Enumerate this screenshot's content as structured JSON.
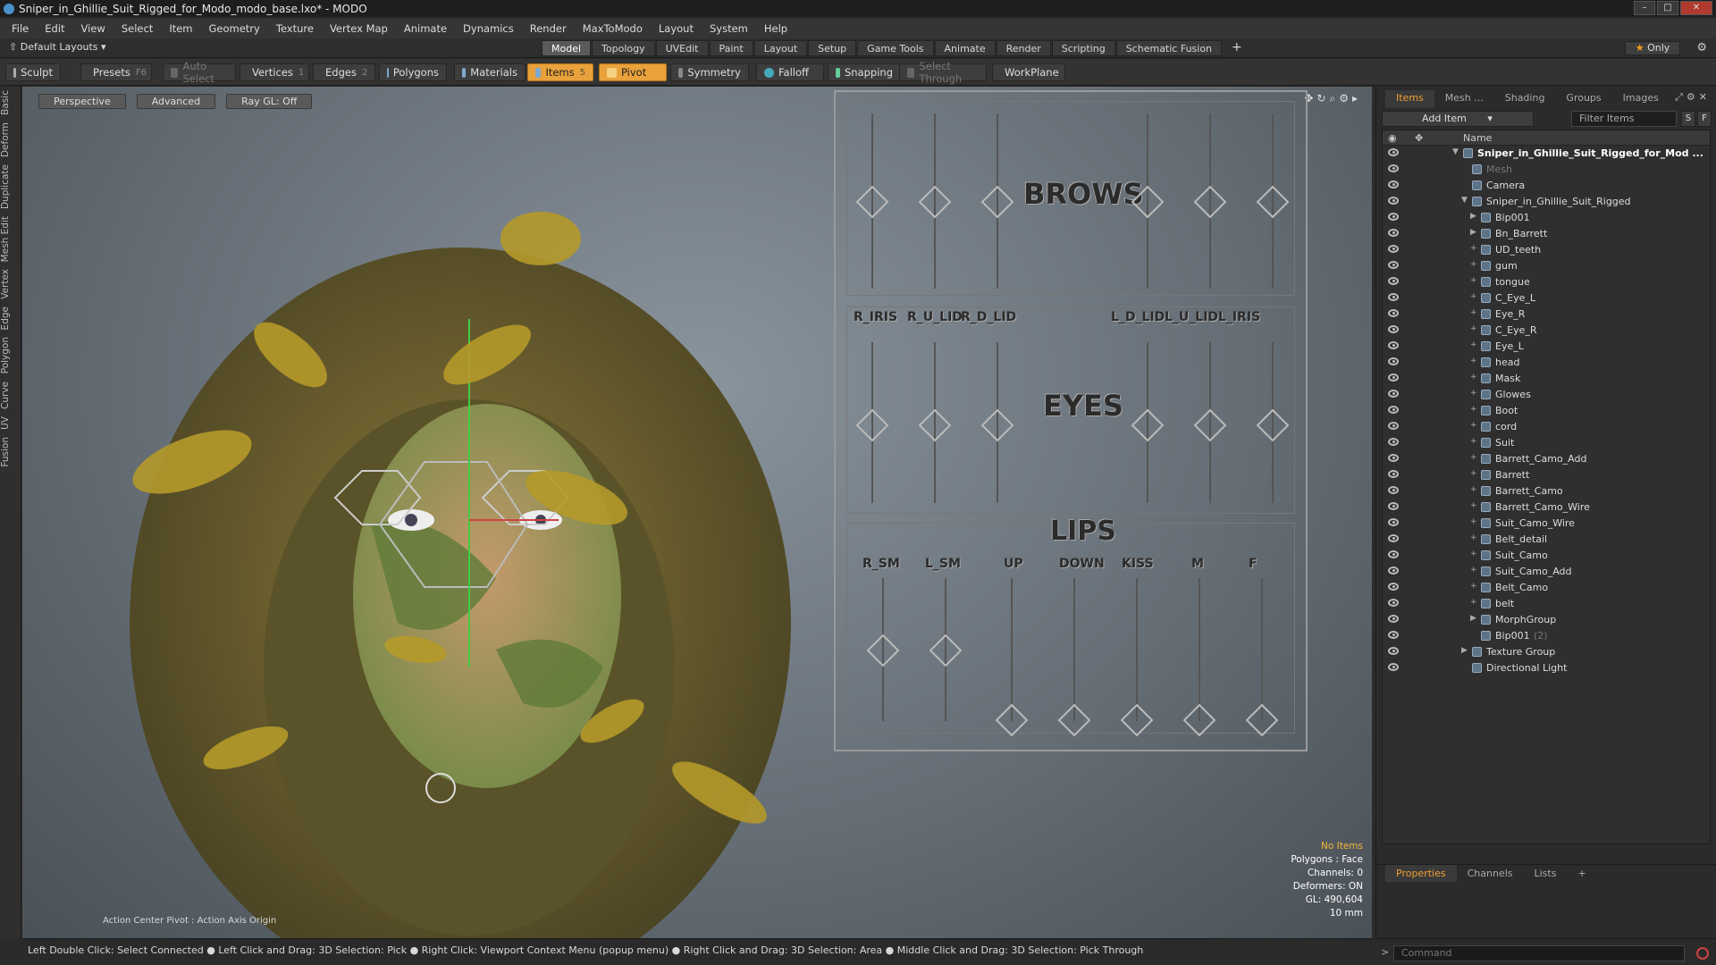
{
  "window": {
    "title": "Sniper_in_Ghillie_Suit_Rigged_for_Modo_modo_base.lxo* - MODO"
  },
  "menu": [
    "File",
    "Edit",
    "View",
    "Select",
    "Item",
    "Geometry",
    "Texture",
    "Vertex Map",
    "Animate",
    "Dynamics",
    "Render",
    "MaxToModo",
    "Layout",
    "System",
    "Help"
  ],
  "layout": {
    "selector": "Default Layouts ▾",
    "tabs": [
      "Model",
      "Topology",
      "UVEdit",
      "Paint",
      "Layout",
      "Setup",
      "Game Tools",
      "Animate",
      "Render",
      "Scripting",
      "Schematic Fusion"
    ],
    "active_tab": "Model",
    "only_label": "Only"
  },
  "toolbar": {
    "sculpt": "Sculpt",
    "presets": "Presets",
    "presets_key": "F6",
    "auto_select": "Auto Select",
    "vertices": "Vertices",
    "vertices_key": "1",
    "edges": "Edges",
    "edges_key": "2",
    "polygons": "Polygons",
    "materials": "Materials",
    "items": "Items",
    "items_key": "5",
    "pivot": "Pivot",
    "symmetry": "Symmetry",
    "falloff": "Falloff",
    "snapping": "Snapping",
    "select_through": "Select Through",
    "workplane": "WorkPlane"
  },
  "left_tabs": [
    "Basic",
    "Deform",
    "Duplicate",
    "Mesh Edit",
    "Vertex",
    "Edge",
    "Polygon",
    "Curve",
    "UV",
    "Fusion"
  ],
  "viewport": {
    "buttons": [
      "Perspective",
      "Advanced",
      "Ray GL: Off"
    ],
    "rig": {
      "brows": "BROWS",
      "eyes": "EYES",
      "lips": "LIPS",
      "eye_labels": [
        "R_IRIS",
        "R_U_LID",
        "R_D_LID",
        "L_D_LID",
        "L_U_LID",
        "L_IRIS"
      ],
      "lip_labels": [
        "R_SM",
        "L_SM",
        "UP",
        "DOWN",
        "KISS",
        "M",
        "F"
      ]
    },
    "stats": {
      "no_items": "No Items",
      "polygons": "Polygons : Face",
      "channels": "Channels: 0",
      "deformers": "Deformers: ON",
      "gl": "GL: 490,604",
      "scale": "10 mm"
    },
    "pivot_info": "Action Center Pivot : Action Axis Origin"
  },
  "right_panel": {
    "tabs": [
      "Items",
      "Mesh ...",
      "Shading",
      "Groups",
      "Images"
    ],
    "active_tab": "Items",
    "add_item": "Add Item",
    "filter_placeholder": "Filter Items",
    "s_btn": "S",
    "f_btn": "F",
    "col_name": "Name",
    "items": [
      {
        "label": "Sniper_in_Ghillie_Suit_Rigged_for_Mod ...",
        "indent": 0,
        "twirl": "▼",
        "bold": true
      },
      {
        "label": "Mesh",
        "indent": 1,
        "twirl": "",
        "dim": true
      },
      {
        "label": "Camera",
        "indent": 1,
        "twirl": ""
      },
      {
        "label": "Sniper_in_Ghillie_Suit_Rigged",
        "indent": 1,
        "twirl": "▼"
      },
      {
        "label": "Bip001",
        "indent": 2,
        "twirl": "▶"
      },
      {
        "label": "Bn_Barrett",
        "indent": 2,
        "twirl": "▶"
      },
      {
        "label": "UD_teeth",
        "indent": 2,
        "twirl": "+"
      },
      {
        "label": "gum",
        "indent": 2,
        "twirl": "+"
      },
      {
        "label": "tongue",
        "indent": 2,
        "twirl": "+"
      },
      {
        "label": "C_Eye_L",
        "indent": 2,
        "twirl": "+"
      },
      {
        "label": "Eye_R",
        "indent": 2,
        "twirl": "+"
      },
      {
        "label": "C_Eye_R",
        "indent": 2,
        "twirl": "+"
      },
      {
        "label": "Eye_L",
        "indent": 2,
        "twirl": "+"
      },
      {
        "label": "head",
        "indent": 2,
        "twirl": "+"
      },
      {
        "label": "Mask",
        "indent": 2,
        "twirl": "+"
      },
      {
        "label": "Glowes",
        "indent": 2,
        "twirl": "+"
      },
      {
        "label": "Boot",
        "indent": 2,
        "twirl": "+"
      },
      {
        "label": "cord",
        "indent": 2,
        "twirl": "+"
      },
      {
        "label": "Suit",
        "indent": 2,
        "twirl": "+"
      },
      {
        "label": "Barrett_Camo_Add",
        "indent": 2,
        "twirl": "+"
      },
      {
        "label": "Barrett",
        "indent": 2,
        "twirl": "+"
      },
      {
        "label": "Barrett_Camo",
        "indent": 2,
        "twirl": "+"
      },
      {
        "label": "Barrett_Camo_Wire",
        "indent": 2,
        "twirl": "+"
      },
      {
        "label": "Suit_Camo_Wire",
        "indent": 2,
        "twirl": "+"
      },
      {
        "label": "Belt_detail",
        "indent": 2,
        "twirl": "+"
      },
      {
        "label": "Suit_Camo",
        "indent": 2,
        "twirl": "+"
      },
      {
        "label": "Suit_Camo_Add",
        "indent": 2,
        "twirl": "+"
      },
      {
        "label": "Belt_Camo",
        "indent": 2,
        "twirl": "+"
      },
      {
        "label": "belt",
        "indent": 2,
        "twirl": "+"
      },
      {
        "label": "MorphGroup",
        "indent": 2,
        "twirl": "▶"
      },
      {
        "label": "Bip001",
        "indent": 2,
        "twirl": "",
        "count": "(2)"
      },
      {
        "label": "Texture Group",
        "indent": 1,
        "twirl": "▶"
      },
      {
        "label": "Directional Light",
        "indent": 1,
        "twirl": ""
      }
    ],
    "bottom_tabs": [
      "Properties",
      "Channels",
      "Lists",
      "+"
    ],
    "bottom_active": "Properties"
  },
  "status": {
    "text": "Left Double Click: Select Connected ● Left Click and Drag: 3D Selection: Pick ● Right Click: Viewport Context Menu (popup menu) ● Right Click and Drag: 3D Selection: Area ● Middle Click and Drag: 3D Selection: Pick Through",
    "command_placeholder": "Command"
  }
}
